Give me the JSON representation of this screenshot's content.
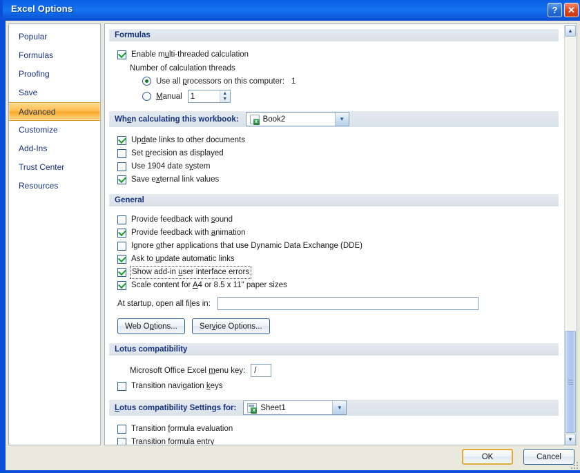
{
  "window": {
    "title": "Excel Options",
    "help_button": "?",
    "close_button": "✕"
  },
  "sidebar": {
    "items": [
      {
        "label": "Popular",
        "selected": false
      },
      {
        "label": "Formulas",
        "selected": false
      },
      {
        "label": "Proofing",
        "selected": false
      },
      {
        "label": "Save",
        "selected": false
      },
      {
        "label": "Advanced",
        "selected": true
      },
      {
        "label": "Customize",
        "selected": false
      },
      {
        "label": "Add-Ins",
        "selected": false
      },
      {
        "label": "Trust Center",
        "selected": false
      },
      {
        "label": "Resources",
        "selected": false
      }
    ]
  },
  "formulas": {
    "header": "Formulas",
    "enable_multithread": {
      "label_pre": "Enable m",
      "accel": "u",
      "label_post": "lti-threaded calculation",
      "checked": true
    },
    "threads_caption": "Number of calculation threads",
    "use_all_processors": {
      "label_pre": "Use all ",
      "accel": "p",
      "label_post": "rocessors on this computer:",
      "selected": true,
      "value": "1"
    },
    "manual": {
      "label_pre": "",
      "accel": "M",
      "label_post": "anual",
      "selected": false,
      "value": "1"
    }
  },
  "workbook": {
    "header_pre": "Wh",
    "header_accel": "e",
    "header_post": "n calculating this workbook:",
    "selected_workbook": "Book2",
    "options": [
      {
        "pre": "Up",
        "accel": "d",
        "post": "ate links to other documents",
        "checked": true
      },
      {
        "pre": "Set ",
        "accel": "p",
        "post": "recision as displayed",
        "checked": false
      },
      {
        "pre": "Use 1904 date s",
        "accel": "y",
        "post": "stem",
        "checked": false
      },
      {
        "pre": "Save e",
        "accel": "x",
        "post": "ternal link values",
        "checked": true
      }
    ]
  },
  "general": {
    "header": "General",
    "options": [
      {
        "pre": "Provide feedback with ",
        "accel": "s",
        "post": "ound",
        "checked": false,
        "focused": false
      },
      {
        "pre": "Provide feedback with ",
        "accel": "a",
        "post": "nimation",
        "checked": true,
        "focused": false
      },
      {
        "pre": "Ignore ",
        "accel": "o",
        "post": "ther applications that use Dynamic Data Exchange (DDE)",
        "checked": false,
        "focused": false
      },
      {
        "pre": "Ask to ",
        "accel": "u",
        "post": "pdate automatic links",
        "checked": true,
        "focused": false
      },
      {
        "pre": "Show add-in ",
        "accel": "u",
        "post": "ser interface errors",
        "checked": true,
        "focused": true
      },
      {
        "pre": "Scale content for ",
        "accel": "A",
        "post": "4 or 8.5 x 11\" paper sizes",
        "checked": true,
        "focused": false
      }
    ],
    "startup_label_pre": "At startup, open all fi",
    "startup_label_accel": "l",
    "startup_label_post": "es in:",
    "startup_value": "",
    "startup_placeholder": "",
    "web_options": {
      "pre": "Web O",
      "accel": "p",
      "post": "tions..."
    },
    "service_options": {
      "pre": "Ser",
      "accel": "v",
      "post": "ice Options..."
    }
  },
  "lotus": {
    "header": "Lotus compatibility",
    "menu_key_label_pre": "Microsoft Office Excel ",
    "menu_key_label_accel": "m",
    "menu_key_label_post": "enu key:",
    "menu_key_value": "/",
    "transition_nav": {
      "pre": "Transition navigation ",
      "accel": "k",
      "post": "eys",
      "checked": false
    }
  },
  "lotus_settings": {
    "header_accel": "L",
    "header_post": "otus compatibility Settings for:",
    "selected_sheet": "Sheet1",
    "options": [
      {
        "pre": "Transition ",
        "accel": "f",
        "post": "ormula evaluation",
        "checked": false
      },
      {
        "pre": "Transition form",
        "accel": "u",
        "post": "la entry",
        "checked": false
      }
    ]
  },
  "scrollbar": {
    "up_arrow": "▲",
    "down_arrow": "▼"
  },
  "footer": {
    "ok_label": "OK",
    "cancel_label": "Cancel"
  },
  "colors": {
    "title_bar": "#1573ef",
    "accent_selected": "#f9a724",
    "section_header_text": "#15317e",
    "sidebar_text": "#15317e",
    "checkmark": "#1a9a28"
  }
}
